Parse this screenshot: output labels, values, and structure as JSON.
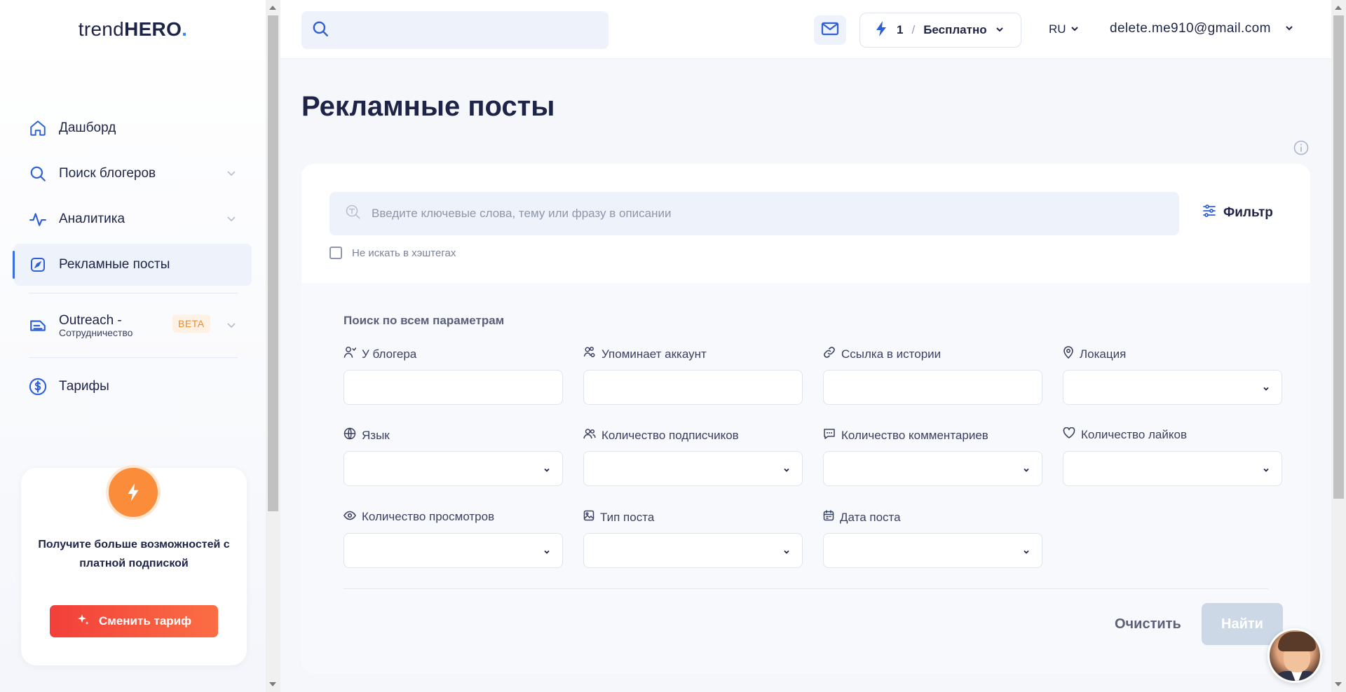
{
  "logo": {
    "part1": "trend",
    "part2": "HERO",
    "dot": "."
  },
  "sidebar": {
    "items": [
      {
        "label": "Дашборд"
      },
      {
        "label": "Поиск блогеров"
      },
      {
        "label": "Аналитика"
      },
      {
        "label": "Рекламные посты"
      },
      {
        "label": "Outreach -",
        "sublabel": "Сотрудничество",
        "badge": "BETA"
      },
      {
        "label": "Тарифы"
      }
    ],
    "promo": {
      "text": "Получите больше возможностей с платной подпиской",
      "button": "Сменить тариф"
    }
  },
  "header": {
    "search_placeholder": "",
    "plan_count": "1",
    "plan_separator": "/",
    "plan_name": "Бесплатно",
    "language": "RU",
    "user_email": "delete.me910@gmail.com"
  },
  "page": {
    "title": "Рекламные посты",
    "keyword_placeholder": "Введите ключевые слова, тему или фразу в описании",
    "filter_label": "Фильтр",
    "hashtag_checkbox": "Не искать в хэштегах",
    "section_title": "Поиск по всем параметрам",
    "fields": [
      {
        "label": "У блогера",
        "icon": "user-search-icon",
        "type": "text"
      },
      {
        "label": "Упоминает аккаунт",
        "icon": "mention-users-icon",
        "type": "text"
      },
      {
        "label": "Ссылка в истории",
        "icon": "link-icon",
        "type": "text"
      },
      {
        "label": "Локация",
        "icon": "location-pin-icon",
        "type": "select"
      },
      {
        "label": "Язык",
        "icon": "globe-icon",
        "type": "select"
      },
      {
        "label": "Количество подписчиков",
        "icon": "users-icon",
        "type": "select"
      },
      {
        "label": "Количество комментариев",
        "icon": "comment-icon",
        "type": "select"
      },
      {
        "label": "Количество лайков",
        "icon": "heart-icon",
        "type": "select"
      },
      {
        "label": "Количество просмотров",
        "icon": "eye-icon",
        "type": "select"
      },
      {
        "label": "Тип поста",
        "icon": "image-icon",
        "type": "select"
      },
      {
        "label": "Дата поста",
        "icon": "calendar-icon",
        "type": "select"
      }
    ],
    "clear_button": "Очистить",
    "find_button": "Найти"
  },
  "colors": {
    "accent": "#3b6fe6",
    "brand_orange": "#fb8c3a",
    "cta_red": "#f23f3a",
    "navy": "#1e2447"
  }
}
